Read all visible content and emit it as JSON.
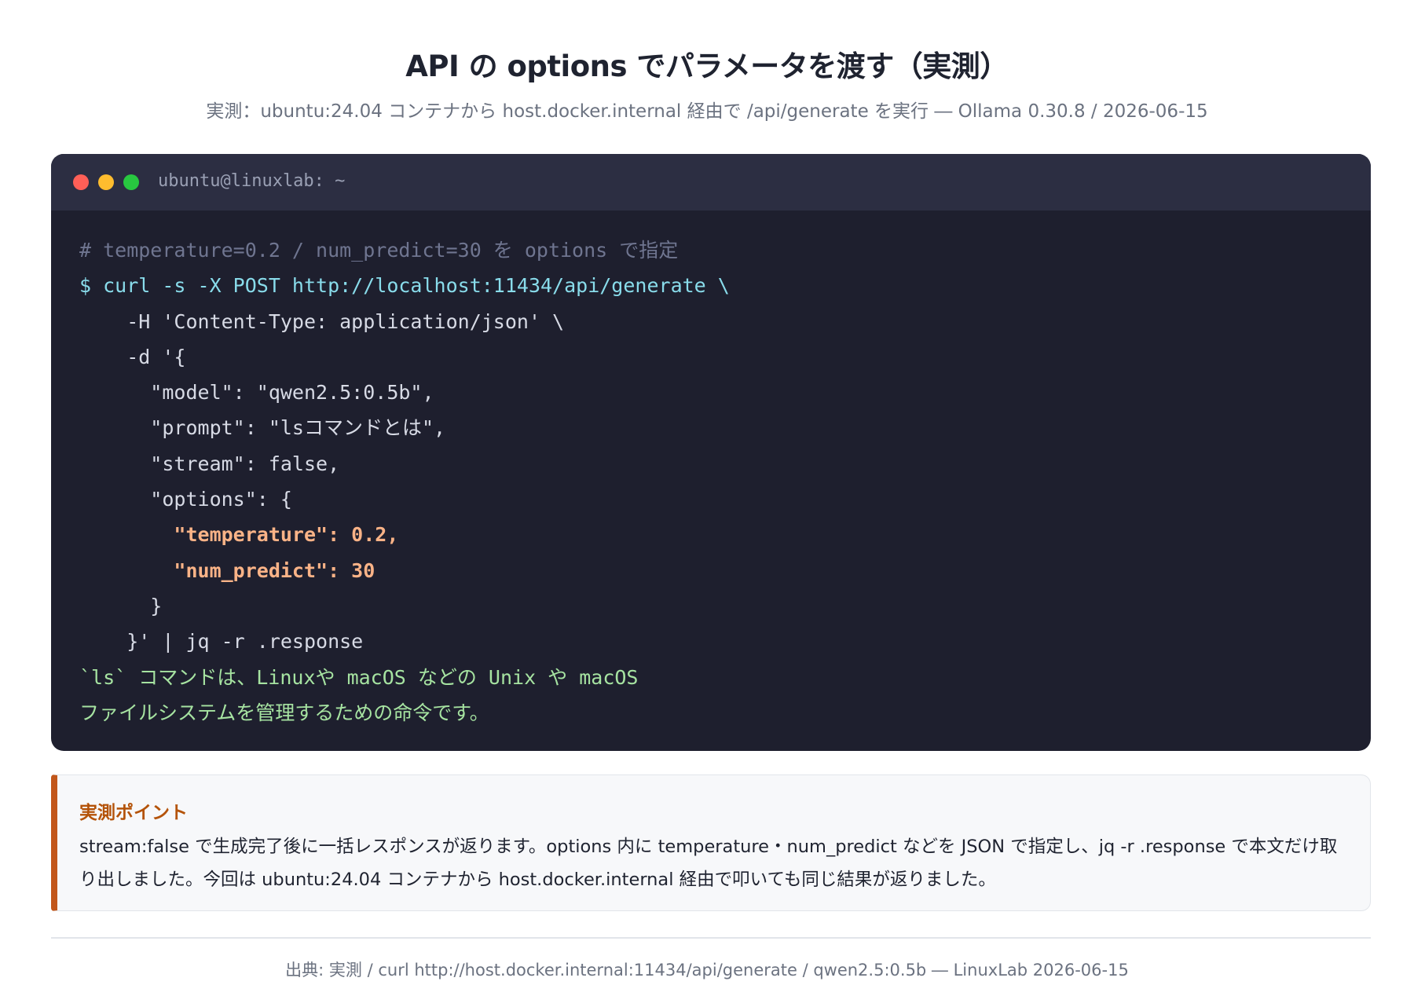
{
  "header": {
    "title": "API の options でパラメータを渡す（実測）",
    "subtitle": "実測：ubuntu:24.04 コンテナから host.docker.internal 経由で /api/generate を実行 ― Ollama 0.30.8 / 2026-06-15"
  },
  "terminal": {
    "window_title": "ubuntu@linuxlab: ~",
    "lines": [
      "# temperature=0.2 / num_predict=30 を options で指定",
      "$ curl -s -X POST http://localhost:11434/api/generate \\",
      "    -H 'Content-Type: application/json' \\",
      "    -d '{",
      "      \"model\": \"qwen2.5:0.5b\",",
      "      \"prompt\": \"lsコマンドとは\",",
      "      \"stream\": false,",
      "      \"options\": {",
      "        \"temperature\": 0.2,",
      "        \"num_predict\": 30",
      "      }",
      "    }' | jq -r .response",
      "`ls` コマンドは、Linuxや macOS などの Unix や macOS",
      "ファイルシステムを管理するための命令です。"
    ]
  },
  "callout": {
    "title": "実測ポイント",
    "body": "stream:false で生成完了後に一括レスポンスが返ります。options 内に temperature・num_predict などを JSON で指定し、jq -r .response で本文だけ取り出しました。今回は ubuntu:24.04 コンテナから host.docker.internal 経由で叩いても同じ結果が返りました。"
  },
  "footer": {
    "source": "出典: 実測 / curl http://host.docker.internal:11434/api/generate / qwen2.5:0.5b ― LinuxLab 2026-06-15"
  },
  "colors": {
    "terminal_bg": "#1e1f2e",
    "terminal_header": "#2c2e42",
    "comment": "#6f7590",
    "command": "#89dceb",
    "highlight": "#fab387",
    "output": "#a6e3a1",
    "accent": "#c2571a"
  }
}
